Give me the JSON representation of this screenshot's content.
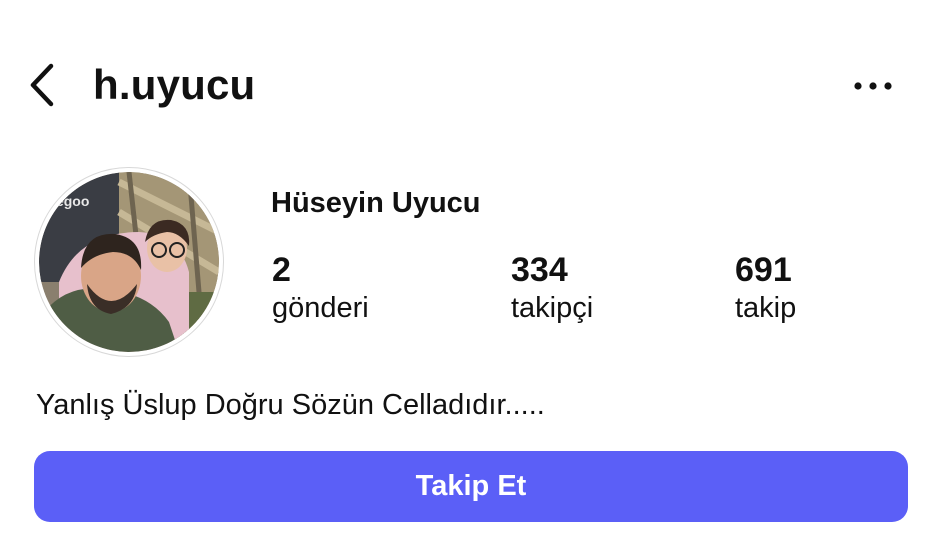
{
  "header": {
    "username": "h.uyucu"
  },
  "profile": {
    "full_name": "Hüseyin Uyucu",
    "stats": [
      {
        "value": "2",
        "label": "gönderi"
      },
      {
        "value": "334",
        "label": "takipçi"
      },
      {
        "value": "691",
        "label": "takip"
      }
    ],
    "bio": "Yanlış Üslup Doğru Sözün Celladıdır.....",
    "avatar_text": "Wegoo"
  },
  "actions": {
    "follow_label": "Takip Et"
  },
  "colors": {
    "accent": "#5b5ff7",
    "text": "#111111",
    "background": "#ffffff"
  },
  "icons": {
    "back": "chevron-left-icon",
    "more": "more-horizontal-icon"
  }
}
